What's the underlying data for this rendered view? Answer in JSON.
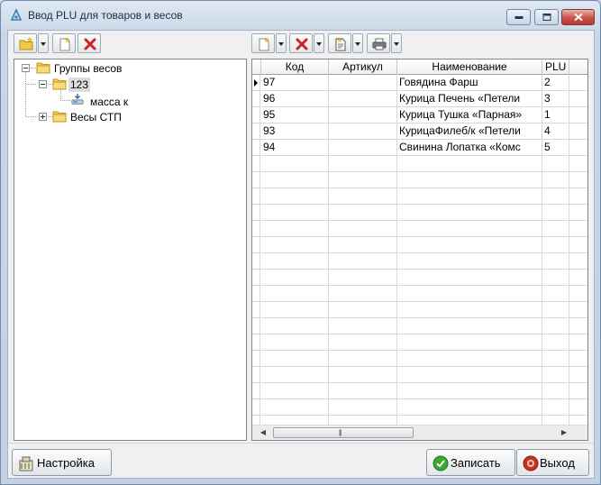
{
  "window": {
    "title": "Ввод PLU для товаров и весов"
  },
  "tree": {
    "nodes": [
      {
        "label": "Группы весов",
        "level": 0,
        "expanded": true
      },
      {
        "label": "123",
        "level": 1,
        "expanded": true,
        "selected": true
      },
      {
        "label": "масса к",
        "level": 2,
        "icon": "scale-icon"
      },
      {
        "label": "Весы СТП",
        "level": 1,
        "expanded": false
      }
    ]
  },
  "grid": {
    "columns": [
      "Код",
      "Артикул",
      "Наименование",
      "PLU"
    ],
    "rows": [
      {
        "code": "97",
        "article": "",
        "name": "Говядина Фарш",
        "plu": "2"
      },
      {
        "code": "96",
        "article": "",
        "name": "Курица Печень  «Петели",
        "plu": "3"
      },
      {
        "code": "95",
        "article": "",
        "name": "Курица Тушка  «Парная»",
        "plu": "1"
      },
      {
        "code": "93",
        "article": "",
        "name": "КурицаФилеб/к «Петели",
        "plu": "4"
      },
      {
        "code": "94",
        "article": "",
        "name": "Свинина Лопатка  «Комс",
        "plu": "5"
      }
    ]
  },
  "buttons": {
    "settings": "Настройка",
    "save": "Записать",
    "exit": "Выход"
  },
  "colors": {
    "accent": "#3c7fb1",
    "delete_red": "#d02020",
    "save_green": "#3aa832",
    "exit_red": "#c8321e"
  }
}
